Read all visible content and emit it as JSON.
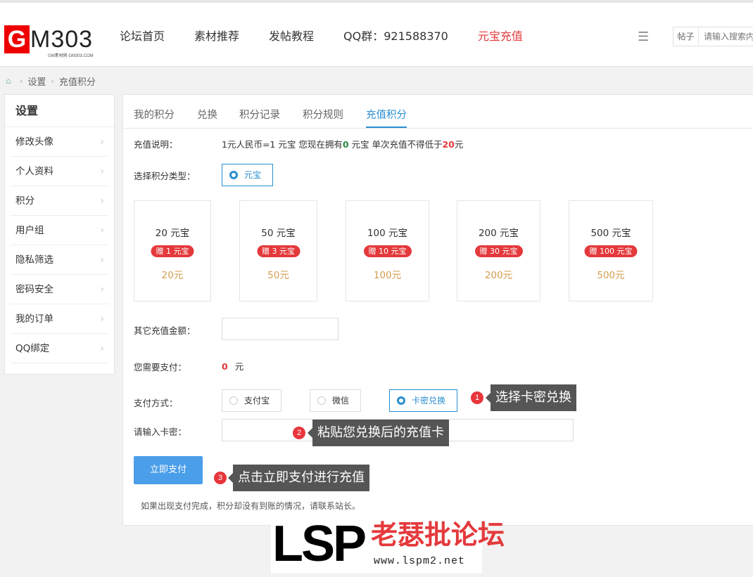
{
  "header": {
    "logo": {
      "letter": "G",
      "text": "M303",
      "subtext": "GM素材网 GM303.COM"
    },
    "nav": [
      {
        "label": "论坛首页",
        "active": false
      },
      {
        "label": "素材推荐",
        "active": false
      },
      {
        "label": "发帖教程",
        "active": false
      },
      {
        "label": "QQ群：921588370",
        "active": false
      },
      {
        "label": "元宝充值",
        "active": true
      }
    ],
    "menu_icon": "list-icon",
    "search": {
      "type_label": "帖子",
      "placeholder": "请输入搜索内"
    }
  },
  "breadcrumb": {
    "home_icon": "home-icon",
    "items": [
      "设置",
      "充值积分"
    ]
  },
  "sidebar": {
    "title": "设置",
    "items": [
      {
        "label": "修改头像"
      },
      {
        "label": "个人资料"
      },
      {
        "label": "积分"
      },
      {
        "label": "用户组"
      },
      {
        "label": "隐私筛选"
      },
      {
        "label": "密码安全"
      },
      {
        "label": "我的订单"
      },
      {
        "label": "QQ绑定"
      }
    ]
  },
  "tabs": [
    {
      "label": "我的积分",
      "active": false
    },
    {
      "label": "兑换",
      "active": false
    },
    {
      "label": "积分记录",
      "active": false
    },
    {
      "label": "积分规则",
      "active": false
    },
    {
      "label": "充值积分",
      "active": true
    }
  ],
  "recharge": {
    "desc_label": "充值说明：",
    "desc_part1": "1元人民币=1 元宝 您现在拥有",
    "desc_owned": "0",
    "desc_part2": " 元宝 单次充值不得低于",
    "desc_min": "20",
    "desc_part3": "元",
    "type_label": "选择积分类型：",
    "type_option": "元宝",
    "packages": [
      {
        "title": "20 元宝",
        "gift": "赠 1 元宝",
        "price": "20元"
      },
      {
        "title": "50 元宝",
        "gift": "赠 3 元宝",
        "price": "50元"
      },
      {
        "title": "100 元宝",
        "gift": "赠 10 元宝",
        "price": "100元"
      },
      {
        "title": "200 元宝",
        "gift": "赠 30 元宝",
        "price": "200元"
      },
      {
        "title": "500 元宝",
        "gift": "赠 100 元宝",
        "price": "500元"
      }
    ],
    "other_amount_label": "其它充值金额：",
    "other_amount_value": "",
    "need_pay_label": "您需要支付：",
    "need_pay_amount": "0",
    "need_pay_unit": "元",
    "pay_method_label": "支付方式：",
    "pay_methods": [
      {
        "label": "支付宝",
        "selected": false
      },
      {
        "label": "微信",
        "selected": false
      },
      {
        "label": "卡密兑换",
        "selected": true
      }
    ],
    "card_key_label": "请输入卡密：",
    "card_key_value": "",
    "pay_button": "立即支付",
    "note": "如果出现支付完成，积分却没有到账的情况，请联系站长。"
  },
  "annotations": [
    {
      "number": "1",
      "text": "选择卡密兑换"
    },
    {
      "number": "2",
      "text": "粘贴您兑换后的充值卡"
    },
    {
      "number": "3",
      "text": "点击立即支付进行充值"
    }
  ],
  "watermark": {
    "brand": "LSP",
    "cn": "老瑟批论坛",
    "url": "www.lspm2.net"
  },
  "colors": {
    "accent": "#2a8ecf",
    "red": "#e4393c",
    "gift": "#e4393c",
    "price": "#d39c4e",
    "button": "#4a9eea",
    "callout": "#555555"
  }
}
